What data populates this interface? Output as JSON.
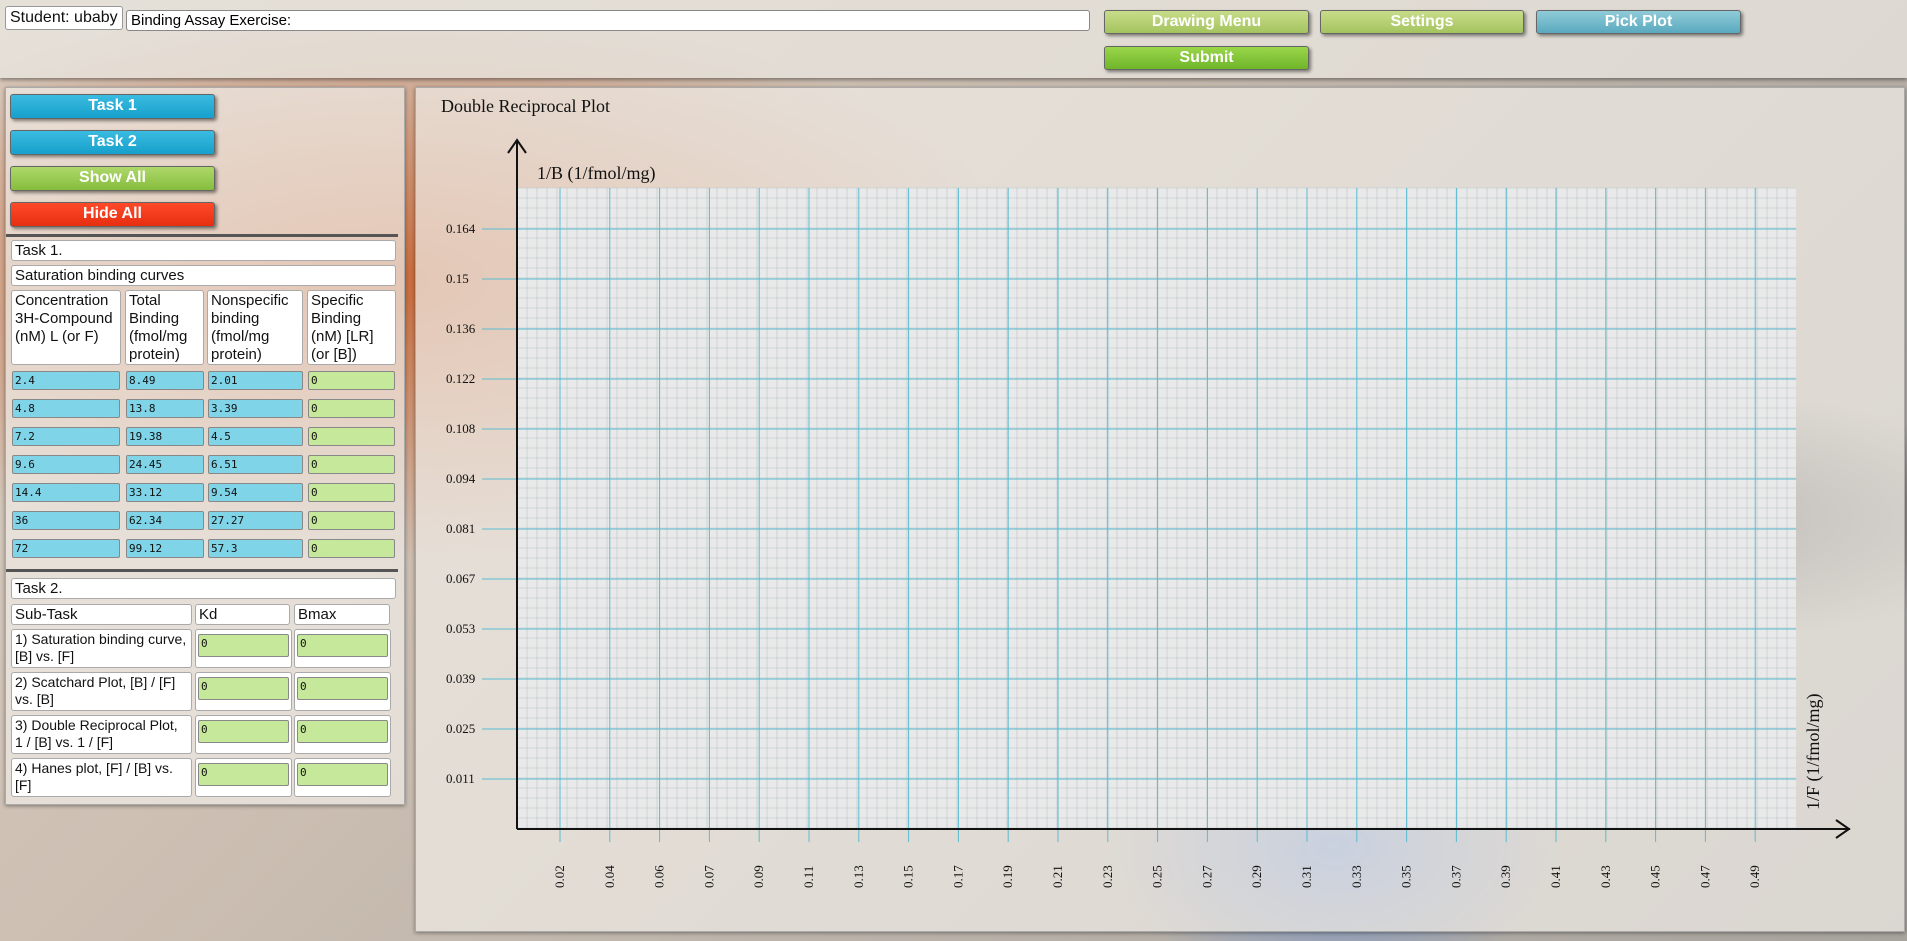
{
  "header": {
    "student": "Student: ubaby",
    "title_value": "Binding Assay Exercise:",
    "drawing_menu": "Drawing Menu",
    "settings": "Settings",
    "pick_plot": "Pick Plot",
    "submit": "Submit"
  },
  "sidebar": {
    "task1_button": "Task 1",
    "task2_button": "Task 2",
    "show_all": "Show All",
    "hide_all": "Hide All"
  },
  "task1": {
    "title": "Task 1.",
    "subtitle": "Saturation binding curves",
    "headers": [
      "Concentration 3H-Compound (nM) L (or F)",
      "Total Binding (fmol/mg protein)",
      "Nonspecific binding (fmol/mg protein)",
      "Specific Binding (nM) [LR] (or [B])"
    ],
    "rows": [
      [
        "2.4",
        "8.49",
        "2.01",
        "0"
      ],
      [
        "4.8",
        "13.8",
        "3.39",
        "0"
      ],
      [
        "7.2",
        "19.38",
        "4.5",
        "0"
      ],
      [
        "9.6",
        "24.45",
        "6.51",
        "0"
      ],
      [
        "14.4",
        "33.12",
        "9.54",
        "0"
      ],
      [
        "36",
        "62.34",
        "27.27",
        "0"
      ],
      [
        "72",
        "99.12",
        "57.3",
        "0"
      ]
    ]
  },
  "task2": {
    "title": "Task 2.",
    "headers": [
      "Sub-Task",
      "Kd",
      "Bmax"
    ],
    "rows": [
      [
        "1) Saturation binding curve, [B] vs. [F]",
        "0",
        "0"
      ],
      [
        "2) Scatchard Plot, [B] / [F]  vs. [B]",
        "0",
        "0"
      ],
      [
        "3) Double Reciprocal Plot, 1 / [B] vs. 1 / [F]",
        "0",
        "0"
      ],
      [
        "4) Hanes plot, [F] / [B] vs. [F]",
        "0",
        "0"
      ]
    ]
  },
  "chart_data": {
    "type": "scatter",
    "title": "Double Reciprocal Plot",
    "ylabel": "1/B (1/fmol/mg)",
    "xlabel": "1/F (1/fmol/mg)",
    "y_ticks": [
      "0.164",
      "0.15",
      "0.136",
      "0.122",
      "0.108",
      "0.094",
      "0.081",
      "0.067",
      "0.053",
      "0.039",
      "0.025",
      "0.011"
    ],
    "x_ticks": [
      "0.02",
      "0.04",
      "0.06",
      "0.07",
      "0.09",
      "0.11",
      "0.13",
      "0.15",
      "0.17",
      "0.19",
      "0.21",
      "0.23",
      "0.25",
      "0.27",
      "0.29",
      "0.31",
      "0.33",
      "0.35",
      "0.37",
      "0.39",
      "0.41",
      "0.43",
      "0.45",
      "0.47",
      "0.49"
    ],
    "points": [],
    "grid": true,
    "grid_color": "#5bbcd0"
  }
}
